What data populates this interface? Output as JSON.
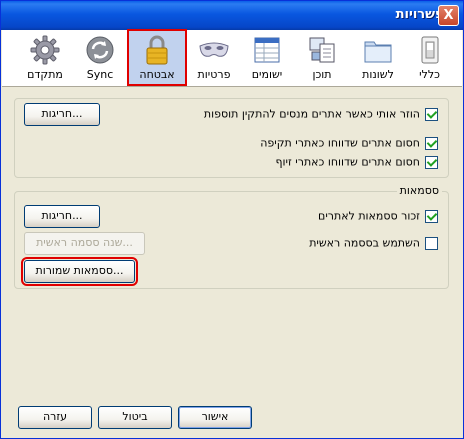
{
  "window": {
    "title": "אפשרויות",
    "close_label": "X"
  },
  "panes": [
    {
      "id": "general",
      "label": "כללי",
      "icon": "light-switch-icon",
      "selected": false
    },
    {
      "id": "tabs",
      "label": "לשונות",
      "icon": "folder-tabs-icon",
      "selected": false
    },
    {
      "id": "content",
      "label": "תוכן",
      "icon": "content-documents-icon",
      "selected": false
    },
    {
      "id": "applications",
      "label": "ישומים",
      "icon": "applications-grid-icon",
      "selected": false
    },
    {
      "id": "privacy",
      "label": "פרטיות",
      "icon": "mask-icon",
      "selected": false
    },
    {
      "id": "security",
      "label": "אבטחה",
      "icon": "padlock-icon",
      "selected": true
    },
    {
      "id": "sync",
      "label": "Sync",
      "icon": "sync-arrows-icon",
      "selected": false
    },
    {
      "id": "advanced",
      "label": "מתקדם",
      "icon": "gear-icon",
      "selected": false
    }
  ],
  "security": {
    "warn_addons_label": "הוזר אותי כאשר אתרים מנסים להתקין תוספות",
    "warn_addons_checked": true,
    "exceptions_label": "חריגות...",
    "block_attack_label": "חסום אתרים שדווחו כאתרי תקיפה",
    "block_attack_checked": true,
    "block_forgery_label": "חסום אתרים שדווחו כאתרי זיוף",
    "block_forgery_checked": true
  },
  "passwords": {
    "caption": "ססמאות",
    "remember_label": "זכור ססמאות לאתרים",
    "remember_checked": true,
    "exceptions_label": "חריגות...",
    "use_master_label": "השתמש בססמה ראשית",
    "use_master_checked": false,
    "change_master_label": "שנה ססמה ראשית...",
    "saved_passwords_label": "ססמאות שמורות..."
  },
  "footer": {
    "ok_label": "אישור",
    "cancel_label": "ביטול",
    "help_label": "עזרה"
  }
}
